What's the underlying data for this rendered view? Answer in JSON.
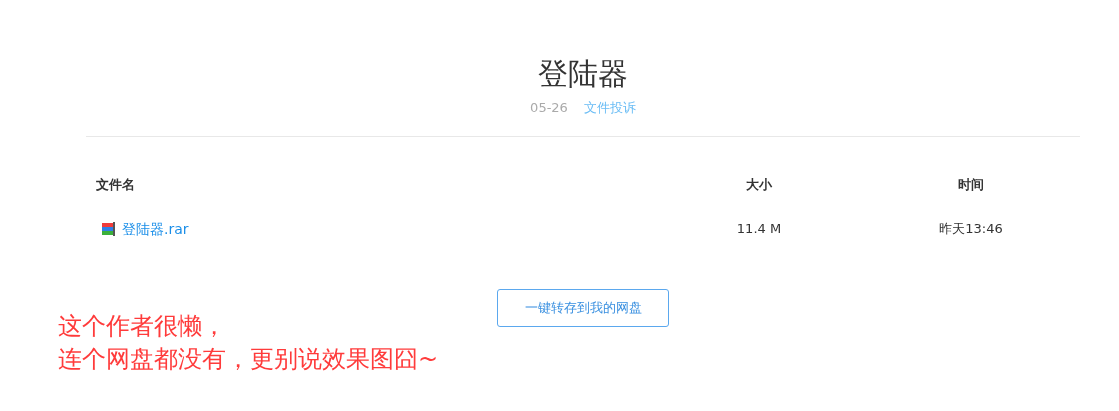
{
  "title": "登陆器",
  "meta": {
    "date": "05-26",
    "report_link": "文件投诉"
  },
  "table": {
    "columns": [
      "文件名",
      "大小",
      "时间"
    ],
    "rows": [
      {
        "name": "登陆器.rar",
        "size": "11.4 M",
        "time": "昨天13:46"
      }
    ]
  },
  "save_button": "一键转存到我的网盘",
  "note": [
    "这个作者很懒，",
    "连个网盘都没有，更别说效果图囧~"
  ]
}
